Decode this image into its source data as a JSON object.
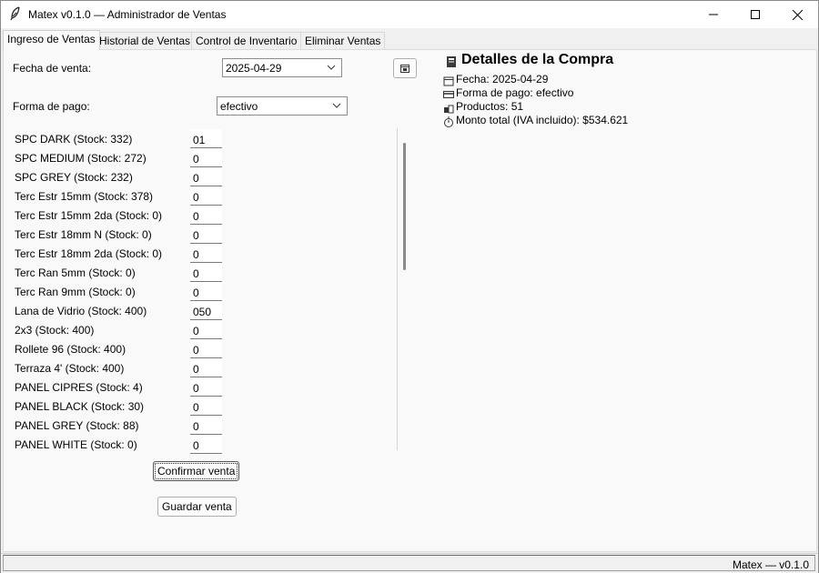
{
  "window": {
    "title": "Matex v0.1.0 — Administrador de Ventas"
  },
  "tabs": [
    {
      "label": "Ingreso de Ventas",
      "active": true
    },
    {
      "label": "Historial de Ventas"
    },
    {
      "label": "Control de Inventario"
    },
    {
      "label": "Eliminar Ventas"
    }
  ],
  "form": {
    "fecha_label": "Fecha de venta:",
    "fecha_value": "2025-04-29",
    "pago_label": "Forma de pago:",
    "pago_value": "efectivo"
  },
  "products": [
    {
      "label": "SPC DARK (Stock: 332)",
      "qty": "01"
    },
    {
      "label": "SPC MEDIUM (Stock: 272)",
      "qty": "0"
    },
    {
      "label": "SPC GREY (Stock: 232)",
      "qty": "0"
    },
    {
      "label": "Terc Estr 15mm (Stock: 378)",
      "qty": "0"
    },
    {
      "label": "Terc Estr 15mm 2da (Stock: 0)",
      "qty": "0"
    },
    {
      "label": "Terc Estr 18mm N (Stock: 0)",
      "qty": "0"
    },
    {
      "label": "Terc Estr 18mm 2da (Stock: 0)",
      "qty": "0"
    },
    {
      "label": "Terc Ran 5mm (Stock: 0)",
      "qty": "0"
    },
    {
      "label": "Terc Ran 9mm (Stock: 0)",
      "qty": "0"
    },
    {
      "label": "Lana de Vidrio (Stock: 400)",
      "qty": "050"
    },
    {
      "label": "2x3 (Stock: 400)",
      "qty": "0"
    },
    {
      "label": "Rollete 96 (Stock: 400)",
      "qty": "0"
    },
    {
      "label": "Terraza 4' (Stock: 400)",
      "qty": "0"
    },
    {
      "label": "PANEL CIPRES (Stock: 4)",
      "qty": "0"
    },
    {
      "label": "PANEL BLACK (Stock: 30)",
      "qty": "0"
    },
    {
      "label": "PANEL GREY (Stock: 88)",
      "qty": "0"
    },
    {
      "label": "PANEL WHITE (Stock: 0)",
      "qty": "0"
    }
  ],
  "buttons": {
    "confirmar": "Confirmar venta",
    "guardar": "Guardar venta"
  },
  "details": {
    "title": "Detalles de la Compra",
    "fecha": "Fecha: 2025-04-29",
    "pago": "Forma de pago: efectivo",
    "productos": "Productos: 51",
    "monto": "Monto total (IVA incluido): $534.621"
  },
  "status": {
    "text": "Matex — v0.1.0"
  }
}
